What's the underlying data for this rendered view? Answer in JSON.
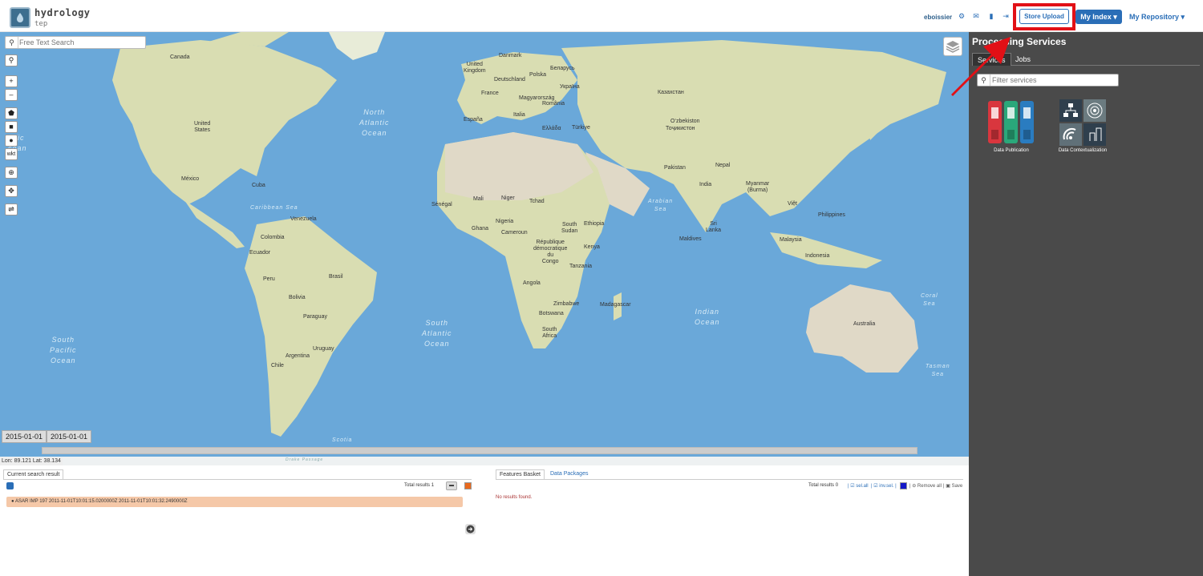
{
  "app": {
    "brand_name": "hydrology",
    "brand_sub": "tep"
  },
  "nav": {
    "user": "eboissier",
    "icons": [
      "gear-icon",
      "envelope-icon",
      "book-icon",
      "signout-icon"
    ],
    "store_upload": "Store Upload",
    "my_index": "My Index",
    "my_repository": "My Repository"
  },
  "map": {
    "search_placeholder": "Free Text Search",
    "tools": [
      "search-icon",
      "zoom-in",
      "zoom-out",
      "polygon",
      "square",
      "marker",
      "wkt",
      "globe",
      "expand",
      "swap"
    ],
    "wkt_label": "wkt",
    "zoom_in": "+",
    "zoom_out": "–",
    "date_start": "2015-01-01",
    "date_end": "2015-01-01",
    "coords": "Lon: 89.121 Lat: 38.134",
    "labels": {
      "canada": "Canada",
      "united_states": "United\nStates",
      "mexico": "México",
      "cuba": "Cuba",
      "venezuela": "Venezuela",
      "colombia": "Colombia",
      "ecuador": "Ecuador",
      "peru": "Peru",
      "brasil": "Brasil",
      "bolivia": "Bolivia",
      "paraguay": "Paraguay",
      "uruguay": "Uruguay",
      "argentina": "Argentina",
      "chile": "Chile",
      "espana": "España",
      "france": "France",
      "deutschland": "Deutschland",
      "polska": "Polska",
      "danmark": "Danmark",
      "uk": "United\nKingdom",
      "italia": "Italia",
      "belarus": "Беларусь",
      "ukraina": "Україна",
      "turkiye": "Türkiye",
      "ellada": "Ελλάδα",
      "magyarorszag": "Magyarország",
      "romania": "România",
      "kazakhstan": "Казахстан",
      "uzbekistan": "O‘zbekiston",
      "tojikiston": "Тоҷикистон",
      "pakistan": "Pakistan",
      "nepal": "Nepal",
      "india": "India",
      "myanmar": "Myanmar\n(Burma)",
      "viet": "Việt",
      "philippines": "Philippines",
      "malaysia": "Malaysia",
      "indonesia": "Indonesia",
      "australia": "Australia",
      "mali": "Mali",
      "niger": "Niger",
      "tchad": "Tchad",
      "senegal": "Sénégal",
      "nigeria": "Nigeria",
      "ghana": "Ghana",
      "cameroun": "Cameroun",
      "south_sudan": "South\nSudan",
      "ethiopia": "Ethiopia",
      "kenya": "Kenya",
      "tanzania": "Tanzania",
      "rdc": "République\ndémocratique\ndu\nCongo",
      "angola": "Angola",
      "zimbabwe": "Zimbabwe",
      "botswana": "Botswana",
      "south_africa": "South\nAfrica",
      "madagascar": "Madagascar",
      "sri_lanka": "Sri\nLanka",
      "maldives": "Maldives",
      "north_atlantic": "North\nAtlantic\nOcean",
      "south_atlantic": "South\nAtlantic\nOcean",
      "south_pacific": "South\nPacific\nOcean",
      "north_pacific": "rth\ncific\ncean",
      "indian_ocean": "Indian\nOcean",
      "arabian_sea": "Arabian\nSea",
      "caribbean": "Caribbean Sea",
      "coral_sea": "Coral\nSea",
      "tasman_sea": "Tasman\nSea",
      "scotia": "Scotia",
      "drake": "Drake Passage"
    }
  },
  "processing": {
    "title": "Processing Services",
    "tabs": [
      "Services",
      "Jobs"
    ],
    "filter_placeholder": "Filter services",
    "services": [
      {
        "label": "Data Publication",
        "icon": "binders-icon"
      },
      {
        "label": "Data Contextualization",
        "icon": "network-icon"
      }
    ]
  },
  "search_results": {
    "tab": "Current search result",
    "total_label": "Total results",
    "total": "1",
    "items": [
      "ASAR IMP 197 2011-11-01T10:01:15.0200000Z 2011-11-01T10:01:32.2490000Z"
    ]
  },
  "basket": {
    "tabs": [
      "Features Basket",
      "Data Packages"
    ],
    "total_label": "Total results",
    "total": "0",
    "select_all": "sel.all",
    "inv_sel": "inv.sel.",
    "remove_all": "Remove all",
    "save": "Save",
    "empty": "No results found."
  },
  "colors": {
    "ocean": "#6aa8d9",
    "land": "#d9ddb2",
    "desert": "#e0d9c7",
    "primary": "#2a6eb7",
    "highlight": "#e21016",
    "panel": "#4a4a4a",
    "result_row": "#f5c8a8"
  }
}
